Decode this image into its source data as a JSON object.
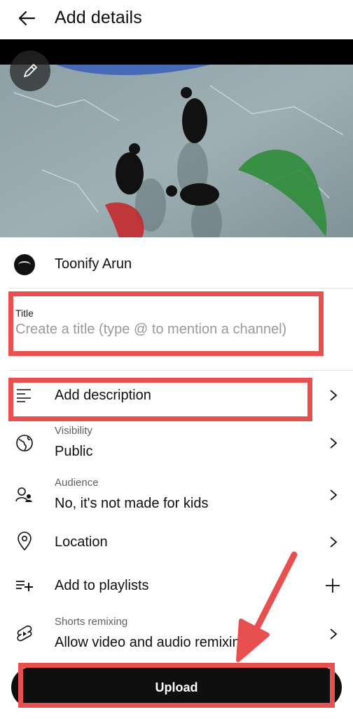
{
  "header": {
    "title": "Add details",
    "back_icon": "arrow-left-icon"
  },
  "video": {
    "edit_icon": "pencil-icon"
  },
  "channel": {
    "name": "Toonify Arun"
  },
  "title_field": {
    "label": "Title",
    "placeholder": "Create a title (type @ to mention a channel)",
    "value": ""
  },
  "options": {
    "description": {
      "label": "Add description",
      "icon": "text-lines-icon"
    },
    "visibility": {
      "small_label": "Visibility",
      "label": "Public",
      "icon": "globe-icon"
    },
    "audience": {
      "small_label": "Audience",
      "label": "No, it's not made for kids",
      "icon": "person-group-icon"
    },
    "location": {
      "label": "Location",
      "icon": "location-pin-icon"
    },
    "playlists": {
      "label": "Add to playlists",
      "icon": "playlist-add-icon",
      "action_icon": "plus-icon"
    },
    "remixing": {
      "small_label": "Shorts remixing",
      "label": "Allow video and audio remixin",
      "icon": "shorts-remix-icon"
    }
  },
  "upload": {
    "label": "Upload"
  },
  "colors": {
    "annotation": "#e8504f",
    "text_primary": "#0f0f0f",
    "text_secondary": "#606060",
    "upload_bg": "#0f0f0f"
  }
}
